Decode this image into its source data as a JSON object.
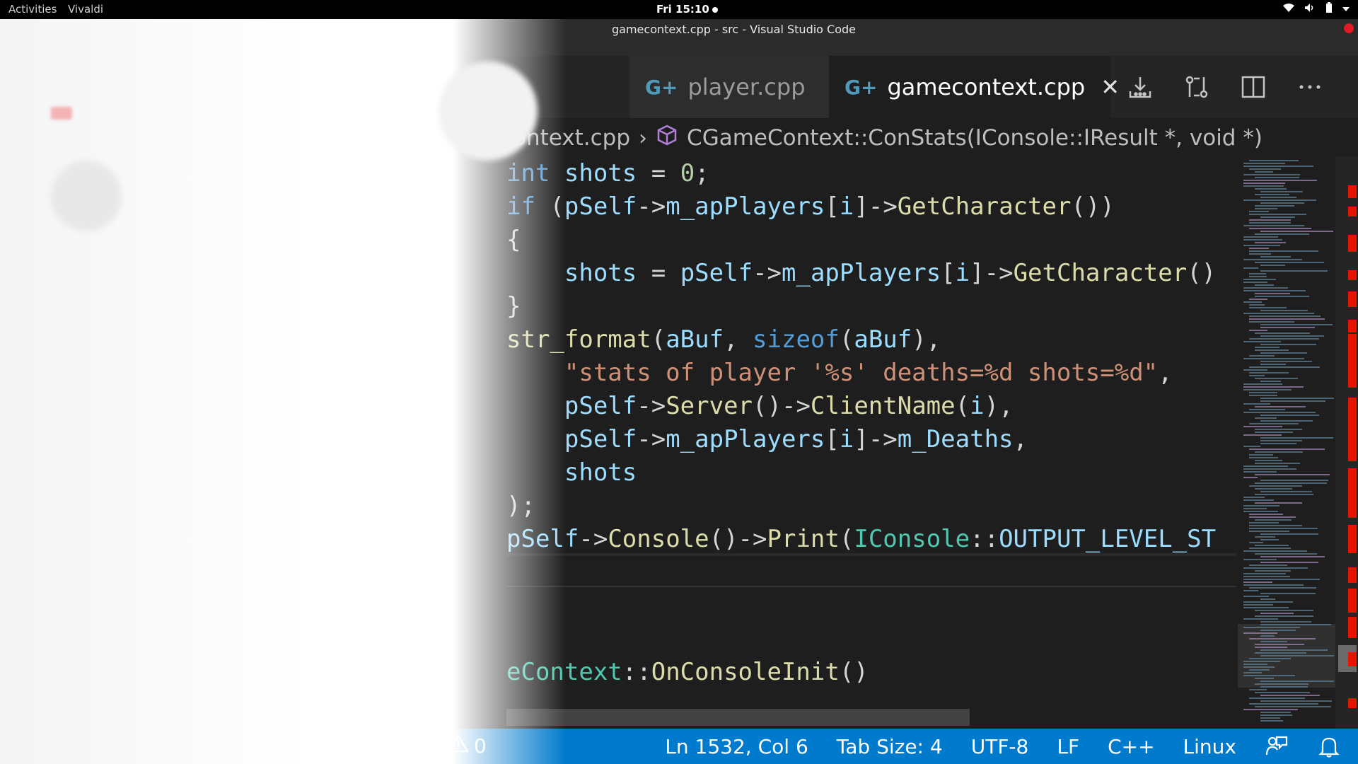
{
  "system_bar": {
    "activities": "Activities",
    "app_menu": "Vivaldi",
    "clock": "Fri 15:10",
    "tray_icons": [
      "wifi-icon",
      "volume-icon",
      "battery-icon",
      "chevron-down-icon"
    ]
  },
  "window": {
    "title": "gamecontext.cpp - src - Visual Studio Code",
    "close_color": "#e01b24"
  },
  "tabs": [
    {
      "label": "player.cpp",
      "active": false,
      "icon": "cpp-file-icon"
    },
    {
      "label": "gamecontext.cpp",
      "active": true,
      "icon": "cpp-file-icon"
    }
  ],
  "tab_actions": [
    "open-changes-icon",
    "compare-icon",
    "split-editor-icon",
    "more-actions-icon"
  ],
  "breadcrumb": {
    "file": "gamecontext.cpp",
    "symbol": "CGameContext::ConStats(IConsole::IResult *, void *)"
  },
  "code_lines": [
    "int shots = 0;",
    "if (pSelf->m_apPlayers[i]->GetCharacter())",
    "{",
    "    shots = pSelf->m_apPlayers[i]->GetCharacter()",
    "}",
    "str_format(aBuf, sizeof(aBuf),",
    "    \"stats of player '%s' deaths=%d shots=%d\",",
    "    pSelf->Server()->ClientName(i),",
    "    pSelf->m_apPlayers[i]->m_Deaths,",
    "    shots",
    ");",
    "pSelf->Console()->Print(IConsole::OUTPUT_LEVEL_ST",
    "",
    "",
    "",
    "eContext::OnConsoleInit()"
  ],
  "status": {
    "warnings": "0",
    "position": "Ln 1532, Col 6",
    "tab_size": "Tab Size: 4",
    "encoding": "UTF-8",
    "eol": "LF",
    "language": "C++",
    "platform": "Linux",
    "icons": [
      "feedback-icon",
      "bell-icon"
    ]
  },
  "colors": {
    "statusbar": "#007acc",
    "editor_bg": "#1e1e1e",
    "keyword": "#569cd6",
    "function": "#dcdcaa",
    "variable": "#9cdcfe",
    "type": "#4ec9b0",
    "string": "#ce9178",
    "number": "#b5cea8"
  }
}
